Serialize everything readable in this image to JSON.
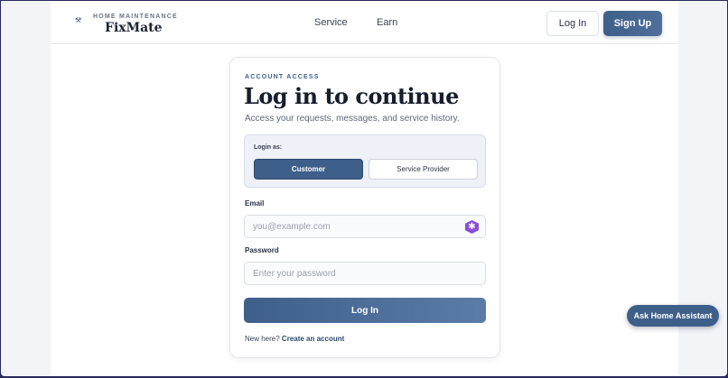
{
  "header": {
    "brand_tag": "HOME MAINTENANCE",
    "brand_name": "FixMate",
    "nav": [
      "Service",
      "Earn"
    ],
    "login_label": "Log In",
    "signup_label": "Sign Up"
  },
  "card": {
    "eyebrow": "ACCOUNT ACCESS",
    "title": "Log in to continue",
    "subtitle": "Access your requests, messages, and service history.",
    "role_label": "Login as:",
    "roles": [
      {
        "label": "Customer",
        "selected": true
      },
      {
        "label": "Service Provider",
        "selected": false
      }
    ],
    "email_label": "Email",
    "email_placeholder": "you@example.com",
    "password_label": "Password",
    "password_placeholder": "Enter your password",
    "submit_label": "Log In",
    "footer_prompt": "New here?",
    "footer_link": "Create an account"
  },
  "assistant": {
    "label": "Ask Home Assistant"
  },
  "colors": {
    "accent": "#3e5f8a",
    "background": "#f3f4f7"
  },
  "icons": {
    "logo": "tool-logo-icon",
    "email_field": "password-manager-icon"
  }
}
